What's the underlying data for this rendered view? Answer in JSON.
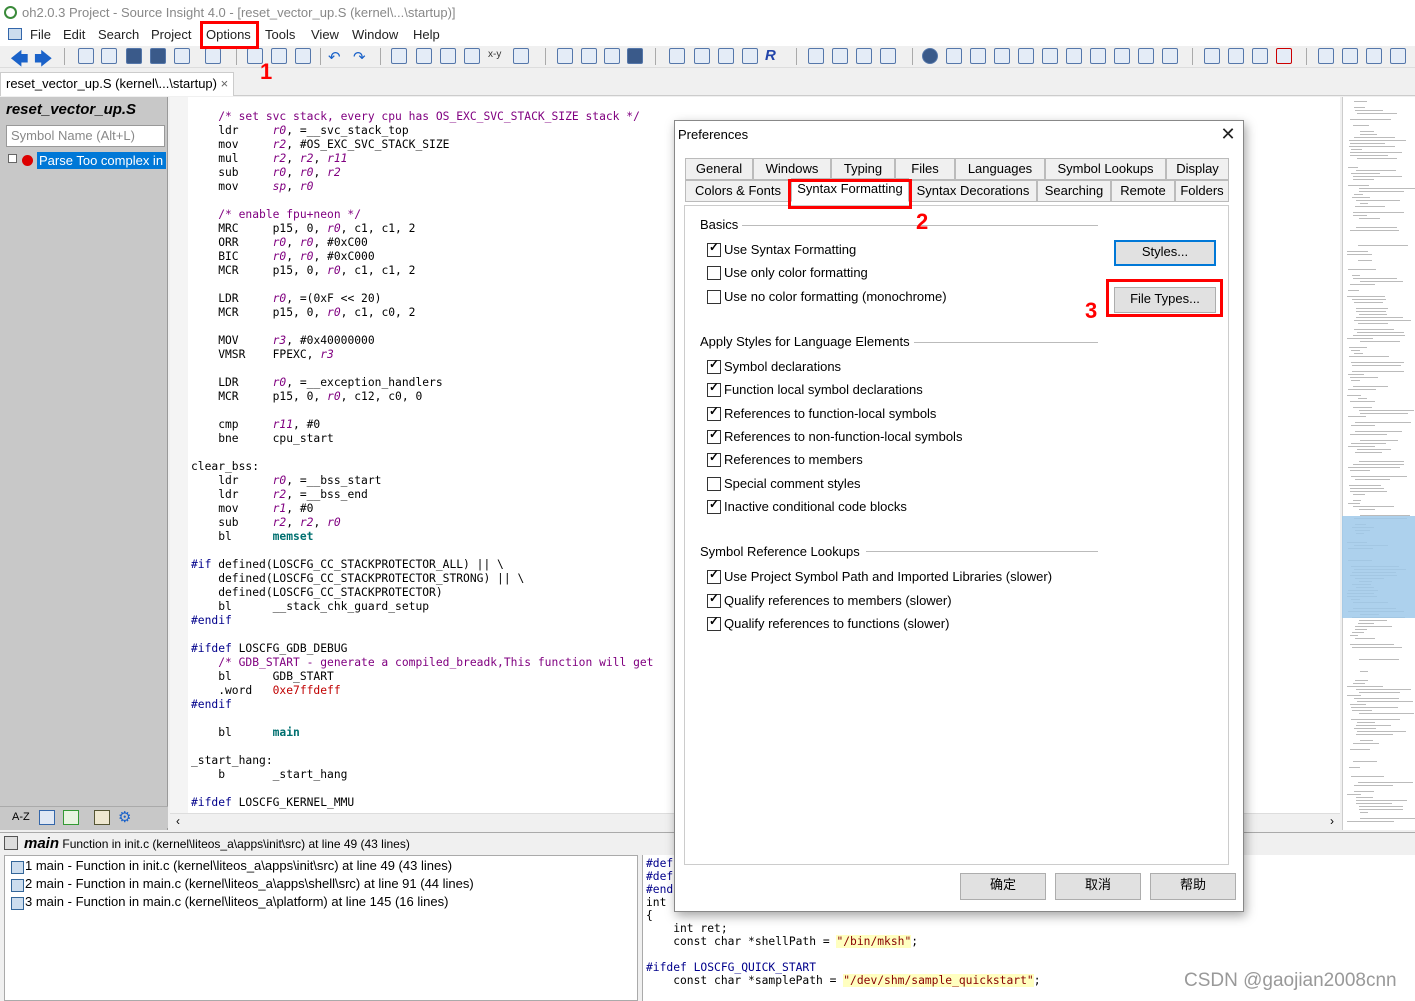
{
  "window": {
    "title": "oh2.0.3 Project - Source Insight 4.0 - [reset_vector_up.S (kernel\\...\\startup)]"
  },
  "menu": [
    "File",
    "Edit",
    "Search",
    "Project",
    "Options",
    "Tools",
    "View",
    "Window",
    "Help"
  ],
  "file_tab": {
    "label": "reset_vector_up.S (kernel\\...\\startup)",
    "close": "×"
  },
  "sidebar": {
    "file_name": "reset_vector_up.S",
    "search_placeholder": "Symbol Name (Alt+L)",
    "node": "Parse Too complex in",
    "sort_label": "A-Z"
  },
  "code_lines": [
    "    /* set svc stack, every cpu has OS_EXC_SVC_STACK_SIZE stack */",
    "    ldr     r0, =__svc_stack_top",
    "    mov     r2, #OS_EXC_SVC_STACK_SIZE",
    "    mul     r2, r2, r11",
    "    sub     r0, r0, r2",
    "    mov     sp, r0",
    "",
    "    /* enable fpu+neon */",
    "    MRC     p15, 0, r0, c1, c1, 2",
    "    ORR     r0, r0, #0xC00",
    "    BIC     r0, r0, #0xC000",
    "    MCR     p15, 0, r0, c1, c1, 2",
    "",
    "    LDR     r0, =(0xF << 20)",
    "    MCR     p15, 0, r0, c1, c0, 2",
    "",
    "    MOV     r3, #0x40000000",
    "    VMSR    FPEXC, r3",
    "",
    "    LDR     r0, =__exception_handlers",
    "    MCR     p15, 0, r0, c12, c0, 0",
    "",
    "    cmp     r11, #0",
    "    bne     cpu_start",
    "",
    "clear_bss:",
    "    ldr     r0, =__bss_start",
    "    ldr     r2, =__bss_end",
    "    mov     r1, #0",
    "    sub     r2, r2, r0",
    "    bl      memset",
    "",
    "#if defined(LOSCFG_CC_STACKPROTECTOR_ALL) || \\",
    "    defined(LOSCFG_CC_STACKPROTECTOR_STRONG) || \\",
    "    defined(LOSCFG_CC_STACKPROTECTOR)",
    "    bl      __stack_chk_guard_setup",
    "#endif",
    "",
    "#ifdef LOSCFG_GDB_DEBUG",
    "    /* GDB_START - generate a compiled_breadk,This function will get",
    "    bl      GDB_START",
    "    .word   0xe7ffdeff",
    "#endif",
    "",
    "    bl      main",
    "",
    "_start_hang:",
    "    b       _start_hang",
    "",
    "#ifdef LOSCFG_KERNEL_MMU"
  ],
  "bottom": {
    "symbol": "main",
    "title": "Function in init.c (kernel\\liteos_a\\apps\\init\\src) at line 49 (43 lines)",
    "results": [
      "1 main - Function in init.c (kernel\\liteos_a\\apps\\init\\src) at line 49 (43 lines)",
      "2 main - Function in main.c (kernel\\liteos_a\\apps\\shell\\src) at line 91 (44 lines)",
      "3 main - Function in main.c (kernel\\liteos_a\\platform) at line 145 (16 lines)"
    ],
    "context_lines": [
      "#def",
      "#def",
      "#end",
      "int",
      "{",
      "    int ret;",
      "    const char *shellPath = \"/bin/mksh\";",
      "",
      "#ifdef LOSCFG_QUICK_START",
      "    const char *samplePath = \"/dev/shm/sample_quickstart\";"
    ]
  },
  "watermark": "CSDN @gaojian2008cnn",
  "dialog": {
    "title": "Preferences",
    "close": "✕",
    "tabs_row1": [
      "General",
      "Windows",
      "Typing",
      "Files",
      "Languages",
      "Symbol Lookups",
      "Display"
    ],
    "tabs_row2": [
      "Colors & Fonts",
      "Syntax Formatting",
      "Syntax Decorations",
      "Searching",
      "Remote",
      "Folders"
    ],
    "selected_tab": "Syntax Formatting",
    "basics": {
      "heading": "Basics",
      "options": [
        {
          "label": "Use Syntax Formatting",
          "checked": true
        },
        {
          "label": "Use only color formatting",
          "checked": false
        },
        {
          "label": "Use no color formatting (monochrome)",
          "checked": false
        }
      ]
    },
    "styles_button": "Styles...",
    "file_types_button": "File Types...",
    "apply": {
      "heading": "Apply Styles for Language Elements",
      "options": [
        {
          "label": "Symbol declarations",
          "checked": true
        },
        {
          "label": "Function local symbol declarations",
          "checked": true
        },
        {
          "label": "References to function-local symbols",
          "checked": true
        },
        {
          "label": "References to non-function-local symbols",
          "checked": true
        },
        {
          "label": "References to members",
          "checked": true
        },
        {
          "label": "Special comment styles",
          "checked": false
        },
        {
          "label": "Inactive conditional code blocks",
          "checked": true
        }
      ]
    },
    "lookups": {
      "heading": "Symbol Reference Lookups",
      "options": [
        {
          "label": "Use Project Symbol Path and Imported Libraries (slower)",
          "checked": true
        },
        {
          "label": "Qualify references to members (slower)",
          "checked": true
        },
        {
          "label": "Qualify references to functions (slower)",
          "checked": true
        }
      ]
    },
    "buttons": {
      "ok": "确定",
      "cancel": "取消",
      "help": "帮助"
    }
  },
  "annotations": [
    "1",
    "2",
    "3"
  ]
}
